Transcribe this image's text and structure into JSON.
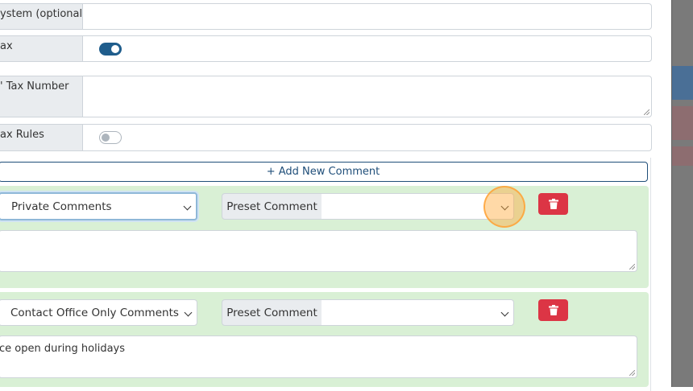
{
  "form": {
    "rows": [
      {
        "label": "ystem (optional)",
        "type": "input"
      },
      {
        "label": "ax",
        "type": "toggle",
        "value": true
      },
      {
        "label": "' Tax Number",
        "type": "textarea"
      },
      {
        "label": "ax Rules",
        "type": "toggle",
        "value": false
      }
    ]
  },
  "comments": {
    "add_button_label": "+ Add New Comment",
    "items": [
      {
        "type": "Private Comments",
        "preset_label": "Preset Comment",
        "preset_value": "",
        "text": ""
      },
      {
        "type": "Contact Office Only Comments",
        "preset_label": "Preset Comment",
        "preset_value": "",
        "text": "ce open during holidays"
      }
    ]
  },
  "colors": {
    "accent": "#1f5d8c",
    "comment_bg": "#d9f0d5",
    "delete": "#dc3545",
    "overlay": "#7a7a7a"
  },
  "icons": {
    "delete": "trash-icon",
    "select": "chevron-down-icon"
  }
}
